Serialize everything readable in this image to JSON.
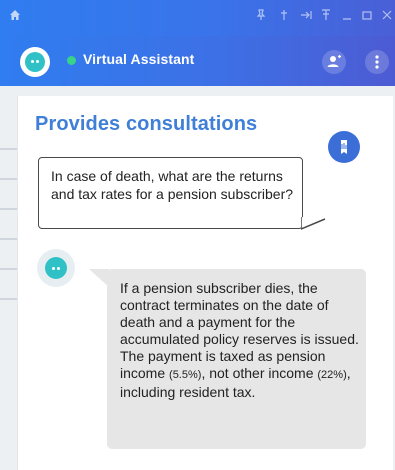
{
  "header": {
    "title": "Virtual Assistant",
    "status_color": "#37d38a",
    "icons": [
      "add-user-icon",
      "more-vert-icon"
    ]
  },
  "titlebar": {
    "icons": [
      "home-icon",
      "pin-icon",
      "pin-icon",
      "arrow-right-icon",
      "push-pin-icon",
      "minimize-icon",
      "maximize-icon",
      "close-icon"
    ]
  },
  "section": {
    "title": "Provides consultations"
  },
  "messages": {
    "user": "In case of death, what are the returns and tax rates for a pension subscriber?",
    "bot": {
      "part1": "If a pension subscriber dies, the contract terminates on the date of death and a payment for the accumulated policy reserves is issued. The payment is taxed as pension income ",
      "rate1": "(5.5%)",
      "part2": ", not other income ",
      "rate2": "(22%)",
      "part3": ", including resident tax."
    }
  },
  "colors": {
    "accent": "#3f7fd8",
    "header_gradient": [
      "#2f7df0",
      "#4d5bd3"
    ],
    "bot_avatar": "#2fc1c6",
    "user_avatar": "#3b6fd7"
  }
}
